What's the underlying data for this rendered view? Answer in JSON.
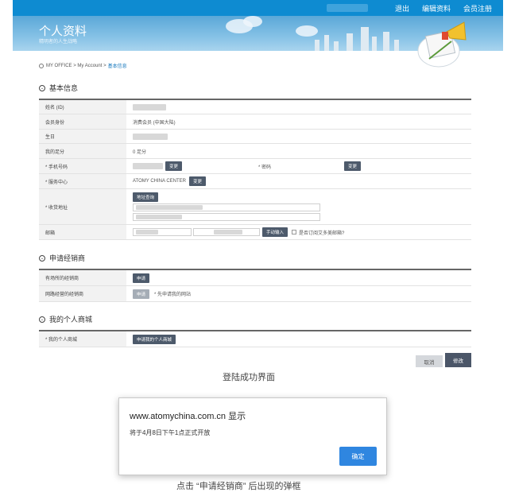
{
  "topbar": {
    "links": [
      "退出",
      "编辑资料",
      "会员注册"
    ]
  },
  "banner": {
    "title": "个人资料",
    "subtitle": "精明者的人生战略"
  },
  "breadcrumb": {
    "path": "MY OFFICE > My Account >",
    "current": "基本信息"
  },
  "basic_info": {
    "heading": "基本信息",
    "rows": {
      "name_label": "姓名 (ID)",
      "member_label": "会员身份",
      "member_value": "消费会员 (中国大陆)",
      "birthday_label": "生日",
      "points_label": "我的足分",
      "points_value": "0 足分",
      "phone_label": "* 手机号码",
      "change_label": "变更",
      "password_label": "* 密码",
      "service_label": "* 服务中心",
      "service_value": "ATOMY CHINA CENTER",
      "address_label": "* 收货地址",
      "address_search": "地址查询",
      "email_label": "邮箱",
      "email_manual": "手动输入",
      "email_subscribe": "是否订阅艾多美邮箱?"
    }
  },
  "distributor": {
    "heading": "申请经销商",
    "rows": {
      "offline_label": "有场所的经销商",
      "offline_btn": "申请",
      "online_label": "网路经营的经销商",
      "online_btn": "申请",
      "online_note": "* 先申请我的网站"
    }
  },
  "mall": {
    "heading": "我的个人商城",
    "rows": {
      "mall_label": "* 我的个人商城",
      "mall_btn": "申请我的个人商城"
    }
  },
  "actions": {
    "cancel": "取消",
    "modify": "修改"
  },
  "captions": {
    "login_success": "登陆成功界面",
    "popup_note": "点击 “申请经销商” 后出现的弹框"
  },
  "dialog": {
    "title": "www.atomychina.com.cn 显示",
    "message": "将于4月8日下午1点正式开放",
    "ok": "确定"
  }
}
